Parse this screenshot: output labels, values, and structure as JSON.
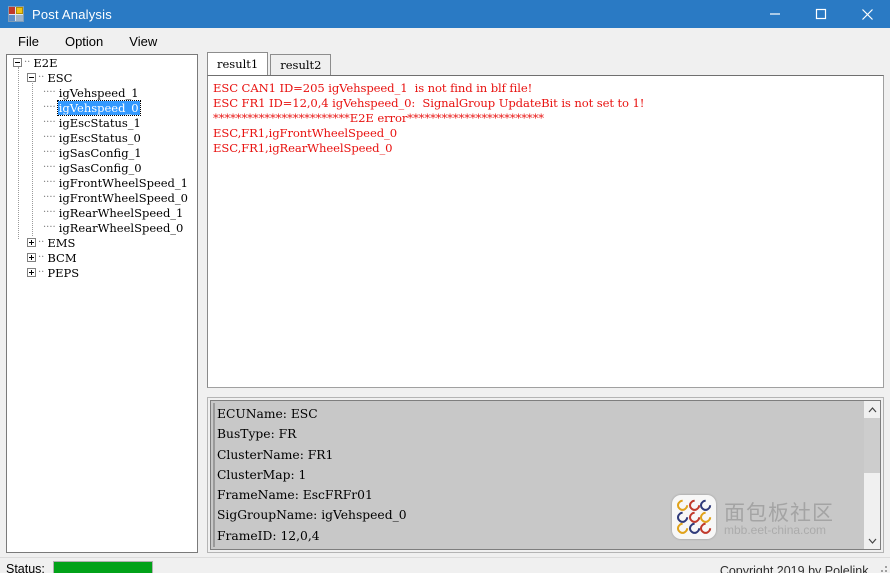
{
  "window": {
    "title": "Post Analysis",
    "icon": "app-icon",
    "minimize_label": "—",
    "maximize_label": "☐",
    "close_label": "✕"
  },
  "menubar": {
    "items": [
      {
        "label": "File"
      },
      {
        "label": "Option"
      },
      {
        "label": "View"
      }
    ]
  },
  "tree": {
    "nodes": [
      {
        "label": "E2E",
        "depth": 0,
        "expander": "minus",
        "selected": false
      },
      {
        "label": "ESC",
        "depth": 1,
        "expander": "minus",
        "selected": false
      },
      {
        "label": "igVehspeed_1",
        "depth": 2,
        "expander": "leaf",
        "selected": false
      },
      {
        "label": "igVehspeed_0",
        "depth": 2,
        "expander": "leaf",
        "selected": true
      },
      {
        "label": "igEscStatus_1",
        "depth": 2,
        "expander": "leaf",
        "selected": false
      },
      {
        "label": "igEscStatus_0",
        "depth": 2,
        "expander": "leaf",
        "selected": false
      },
      {
        "label": "igSasConfig_1",
        "depth": 2,
        "expander": "leaf",
        "selected": false
      },
      {
        "label": "igSasConfig_0",
        "depth": 2,
        "expander": "leaf",
        "selected": false
      },
      {
        "label": "igFrontWheelSpeed_1",
        "depth": 2,
        "expander": "leaf",
        "selected": false
      },
      {
        "label": "igFrontWheelSpeed_0",
        "depth": 2,
        "expander": "leaf",
        "selected": false
      },
      {
        "label": "igRearWheelSpeed_1",
        "depth": 2,
        "expander": "leaf",
        "selected": false
      },
      {
        "label": "igRearWheelSpeed_0",
        "depth": 2,
        "expander": "leaf",
        "selected": false
      },
      {
        "label": "EMS",
        "depth": 1,
        "expander": "plus",
        "selected": false
      },
      {
        "label": "BCM",
        "depth": 1,
        "expander": "plus",
        "selected": false
      },
      {
        "label": "PEPS",
        "depth": 1,
        "expander": "plus",
        "selected": false
      }
    ]
  },
  "tabs": [
    {
      "label": "result1",
      "active": true
    },
    {
      "label": "result2",
      "active": false
    }
  ],
  "result": {
    "text_color": "#e8110f",
    "lines": [
      "ESC CAN1 ID=205 igVehspeed_1  is not find in blf file!",
      "ESC FR1 ID=12,0,4 igVehspeed_0:  SignalGroup UpdateBit is not set to 1!",
      "************************E2E error************************",
      "ESC,FR1,igFrontWheelSpeed_0",
      "ESC,FR1,igRearWheelSpeed_0"
    ]
  },
  "detail": {
    "lines": [
      "ECUName: ESC",
      "BusType: FR",
      "ClusterName: FR1",
      "ClusterMap: 1",
      "FrameName: EscFRFr01",
      "SigGroupName: igVehspeed_0",
      "FrameID: 12,0,4"
    ],
    "scroll_up_label": "▲",
    "scroll_down_label": "▼"
  },
  "statusbar": {
    "label": "Status:",
    "progress_percent": 100,
    "progress_color": "#02a219",
    "copyright": "Copyright 2019 by Polelink."
  },
  "watermark": {
    "chinese": "面包板社区",
    "url": "mbb.eet-china.com"
  }
}
